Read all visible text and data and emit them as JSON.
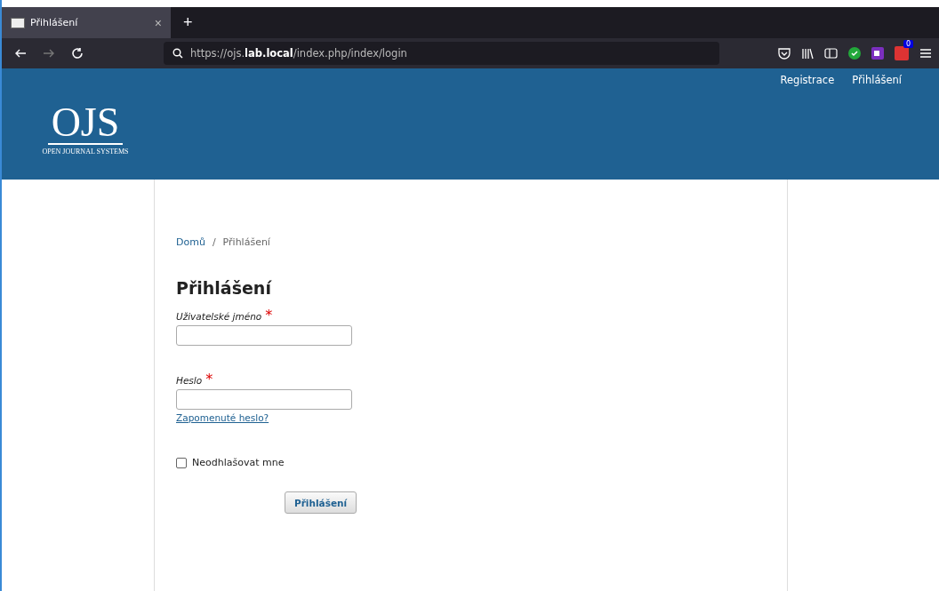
{
  "browser": {
    "tab": {
      "title": "Přihlášení",
      "close": "×",
      "selected": true
    },
    "new_tab": "+",
    "url": "https://ojs.**lab.local**/index.php/index/login",
    "extension_badge": "0"
  },
  "header": {
    "nav": [
      "Registrace",
      "Přihlášení"
    ],
    "logo": {
      "title": "OJS",
      "subtitle": "OPEN JOURNAL SYSTEMS"
    }
  },
  "breadcrumb": {
    "home": "Domů",
    "separator": "/",
    "current": "Přihlášení"
  },
  "page_title": "Přihlášení",
  "fields": [
    {
      "label": "Uživatelské jméno",
      "required": "*"
    },
    {
      "label": "Heslo",
      "required": "*",
      "link": "Zapomenuté heslo?"
    }
  ],
  "remember": {
    "label": "Neodhlašovat mne",
    "checked": false
  },
  "submit": "Přihlášení"
}
